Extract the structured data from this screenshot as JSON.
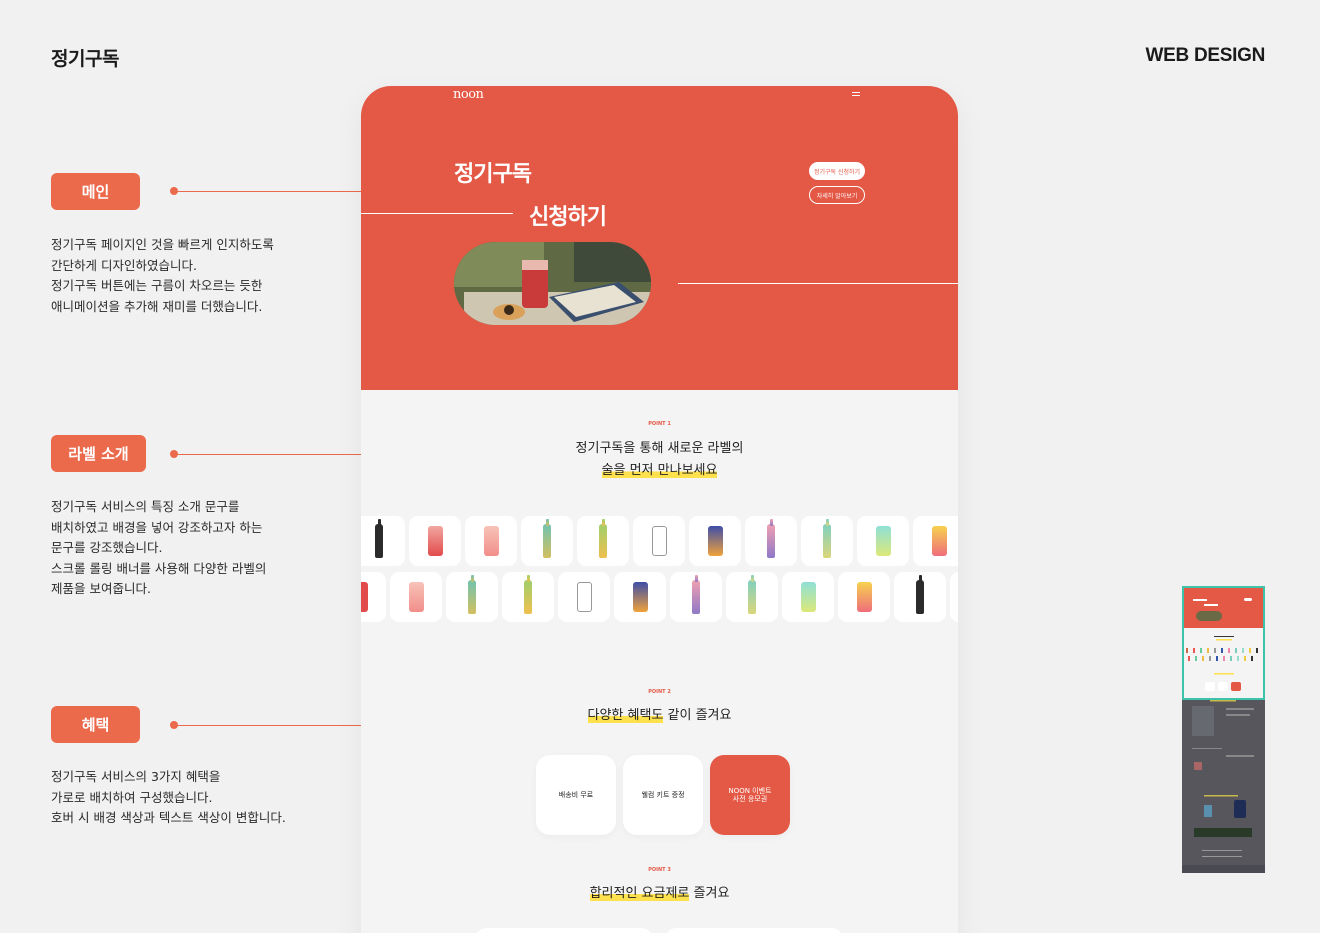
{
  "header": {
    "title": "정기구독",
    "tag": "WEB DESIGN"
  },
  "sections": [
    {
      "tag": "메인",
      "desc": "정기구독 페이지인 것을 빠르게 인지하도록\n간단하게 디자인하였습니다.\n정기구독 버튼에는 구름이 차오르는 듯한\n애니메이션을 추가해 재미를 더했습니다."
    },
    {
      "tag": "라벨 소개",
      "desc": "정기구독 서비스의 특징 소개 문구를\n배치하였고 배경을 넣어 강조하고자 하는\n문구를 강조했습니다.\n스크롤 롤링 배너를 사용해 다양한 라벨의\n제품을 보여줍니다."
    },
    {
      "tag": "혜택",
      "desc": "정기구독 서비스의 3가지 혜택을\n가로로 배치하여 구성했습니다.\n호버 시 배경 색상과 텍스트 색상이 변합니다."
    }
  ],
  "mock": {
    "logo": "noon",
    "hero_line1": "정기구독",
    "hero_line2": "신청하기",
    "subscribe_button": "정기구독 신청하기",
    "more_button": "자세히 알아보기",
    "point1": {
      "label": "POINT 1",
      "line1": "정기구독을 통해 새로운 라벨의",
      "line2": "술을 먼저 만나보세요"
    },
    "point2": {
      "label": "POINT 2",
      "highlight": "다양한 혜택도",
      "rest": " 같이 즐겨요"
    },
    "benefits": [
      "배송비 무료",
      "웰컴 키트 증정",
      "NOON 이벤트 사전 응모권"
    ],
    "point3": {
      "label": "POINT 3",
      "highlight": "합리적인 요금제로",
      "rest": " 즐겨요"
    }
  },
  "colors": {
    "accent": "#e45846",
    "tag": "#ec6a4c",
    "highlight": "#ffe04d",
    "thumb_border": "#3cc3a9"
  },
  "icons": [
    "menu-icon",
    "bottle-icon",
    "can-icon"
  ]
}
